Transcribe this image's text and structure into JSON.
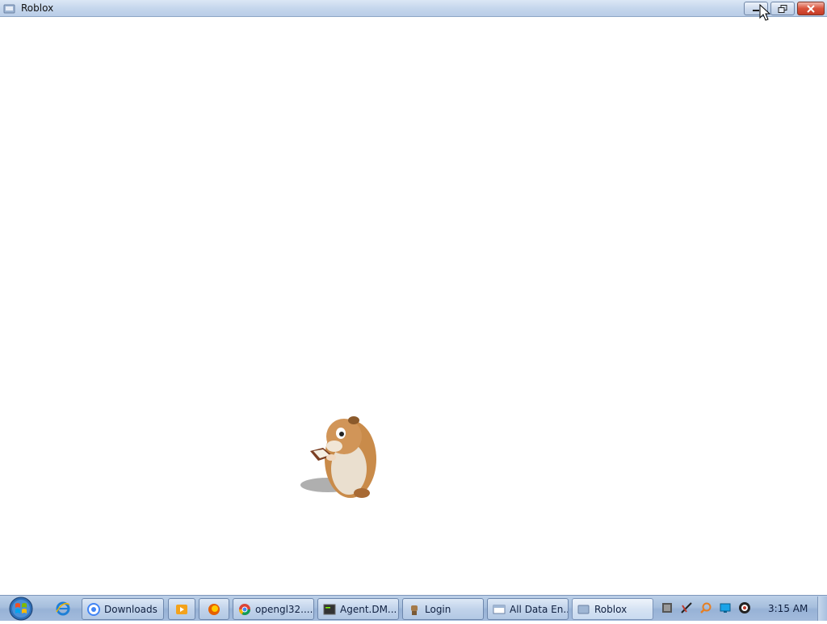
{
  "window": {
    "title": "Roblox",
    "caption": {
      "minimize": "minimize",
      "restore": "restore",
      "close": "close"
    }
  },
  "taskbar": {
    "start_icon": "windows-start-orb",
    "quick_launch": [
      {
        "name": "internet-explorer-icon"
      }
    ],
    "buttons": [
      {
        "label": "Downloads",
        "icon": "chrome-downloads-icon"
      },
      {
        "label": "",
        "icon": "media-player-icon"
      },
      {
        "label": "",
        "icon": "firefox-icon"
      },
      {
        "label": "opengl32....",
        "icon": "chrome-icon"
      },
      {
        "label": "Agent.DM...",
        "icon": "terminal-icon"
      },
      {
        "label": "Login",
        "icon": "robot-icon"
      },
      {
        "label": "All Data En...",
        "icon": "window-icon"
      },
      {
        "label": "Roblox",
        "icon": "roblox-icon"
      }
    ],
    "tray_icons": [
      "network-icon",
      "tools-icon",
      "search-icon",
      "display-icon",
      "media-icon"
    ],
    "clock": "3:15 AM"
  },
  "colors": {
    "titlebar": "#c4d6ec",
    "taskbar": "#a7bfdd",
    "close": "#d9533c"
  }
}
